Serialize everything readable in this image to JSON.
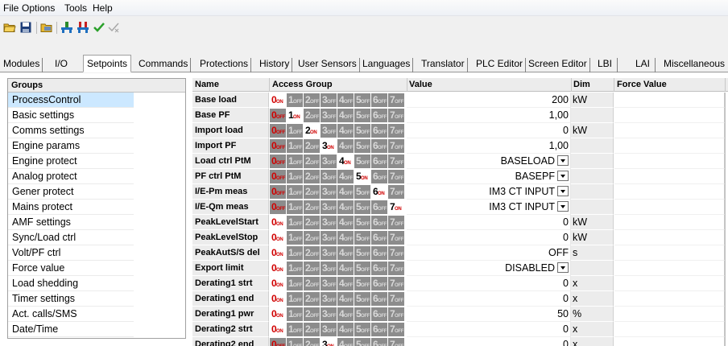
{
  "menu": [
    "File",
    "Options",
    "Tools",
    "Help"
  ],
  "toolbar": {
    "icons": [
      "open-folder-icon",
      "save-icon",
      "print-icon",
      "connect-icon",
      "disconnect-icon",
      "checkmark-icon",
      "history-icon"
    ]
  },
  "tabs": [
    "Modules",
    "I/O",
    "Setpoints",
    "Commands",
    "Protections",
    "History",
    "User Sensors",
    "Languages",
    "Translator",
    "PLC Editor",
    "Screen Editor",
    "LBI",
    "LAI",
    "Miscellaneous"
  ],
  "active_tab": "Setpoints",
  "groups": {
    "header": "Groups",
    "items": [
      "ProcessControl",
      "Basic settings",
      "Comms settings",
      "Engine params",
      "Engine protect",
      "Analog protect",
      "Gener protect",
      "Mains protect",
      "AMF settings",
      "Sync/Load ctrl",
      "Volt/PF ctrl",
      "Force value",
      "Load shedding",
      "Timer settings",
      "Act. calls/SMS",
      "Date/Time"
    ],
    "selected": "ProcessControl"
  },
  "table": {
    "headers": {
      "name": "Name",
      "access": "Access Group",
      "value": "Value",
      "dim": "Dim",
      "force": "Force Value"
    },
    "on_suffix": "ON",
    "off_suffix": "OFF",
    "rows": [
      {
        "name": "Base load",
        "access": 0,
        "value": "200",
        "dim": "kW",
        "dropdown": false
      },
      {
        "name": "Base PF",
        "access": 1,
        "value": "1,00",
        "dim": "",
        "dropdown": false
      },
      {
        "name": "Import load",
        "access": 2,
        "value": "0",
        "dim": "kW",
        "dropdown": false
      },
      {
        "name": "Import PF",
        "access": 3,
        "value": "1,00",
        "dim": "",
        "dropdown": false
      },
      {
        "name": "Load ctrl PtM",
        "access": 4,
        "value": "BASELOAD",
        "dim": "",
        "dropdown": true
      },
      {
        "name": "PF ctrl PtM",
        "access": 5,
        "value": "BASEPF",
        "dim": "",
        "dropdown": true
      },
      {
        "name": "I/E-Pm meas",
        "access": 6,
        "value": "IM3 CT INPUT",
        "dim": "",
        "dropdown": true
      },
      {
        "name": "I/E-Qm meas",
        "access": 7,
        "value": "IM3 CT INPUT",
        "dim": "",
        "dropdown": true
      },
      {
        "name": "PeakLevelStart",
        "access": 0,
        "value": "0",
        "dim": "kW",
        "dropdown": false
      },
      {
        "name": "PeakLevelStop",
        "access": 0,
        "value": "0",
        "dim": "kW",
        "dropdown": false
      },
      {
        "name": "PeakAutS/S del",
        "access": 0,
        "value": "OFF",
        "dim": "s",
        "dropdown": false
      },
      {
        "name": "Export limit",
        "access": 0,
        "value": "DISABLED",
        "dim": "",
        "dropdown": true
      },
      {
        "name": "Derating1 strt",
        "access": 0,
        "value": "0",
        "dim": "x",
        "dropdown": false
      },
      {
        "name": "Derating1 end",
        "access": 0,
        "value": "0",
        "dim": "x",
        "dropdown": false
      },
      {
        "name": "Derating1 pwr",
        "access": 0,
        "value": "50",
        "dim": "%",
        "dropdown": false
      },
      {
        "name": "Derating2 strt",
        "access": 0,
        "value": "0",
        "dim": "x",
        "dropdown": false
      },
      {
        "name": "Derating2 end",
        "access": 3,
        "value": "0",
        "dim": "x",
        "dropdown": false
      }
    ]
  },
  "colors": {
    "selected_group": "#cce8ff",
    "access_off": "#8c8c8c",
    "on_red": "#d00000"
  }
}
